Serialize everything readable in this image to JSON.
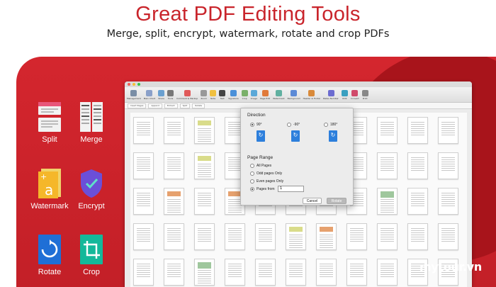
{
  "headline": "Great PDF Editing Tools",
  "subline": "Merge, split, encrypt, watermark, rotate and crop PDFs",
  "colors": {
    "red": "#c9242b",
    "panel": "#d4262e",
    "dark": "#a8141b",
    "blue": "#1f6fd6",
    "teal": "#14b89a"
  },
  "tools": [
    {
      "name": "split",
      "label": "Split",
      "icon": "split-icon"
    },
    {
      "name": "merge",
      "label": "Merge",
      "icon": "merge-icon"
    },
    {
      "name": "watermark",
      "label": "Watermark",
      "icon": "watermark-icon"
    },
    {
      "name": "encrypt",
      "label": "Encrypt",
      "icon": "shield-check-icon"
    },
    {
      "name": "rotate",
      "label": "Rotate",
      "icon": "rotate-icon"
    },
    {
      "name": "crop",
      "label": "Crop",
      "icon": "crop-icon"
    }
  ],
  "app": {
    "toolbar": [
      "Management",
      "Main Chart",
      "Share",
      "Tools",
      "Comment & Markup",
      "Zoom",
      "Note",
      "Text",
      "Signature",
      "Crop",
      "Image",
      "Page Edit",
      "Watermark",
      "Background",
      "Header & Footer",
      "Bates Number",
      "OCR",
      "Convert",
      "Print"
    ],
    "subbar": [
      "Insert Pages",
      "Append",
      "Extract",
      "Split",
      "Rotate"
    ]
  },
  "dialog": {
    "direction_title": "Direction",
    "directions": [
      "90°",
      "-90°",
      "180°"
    ],
    "range_title": "Page Range",
    "ranges": [
      "All Pages",
      "Odd pages Only",
      "Even pages Only",
      "Pages from"
    ],
    "pages_from_value": "1",
    "cancel": "Cancel",
    "rotate": "Rotate"
  },
  "brand": "mytour.vn"
}
